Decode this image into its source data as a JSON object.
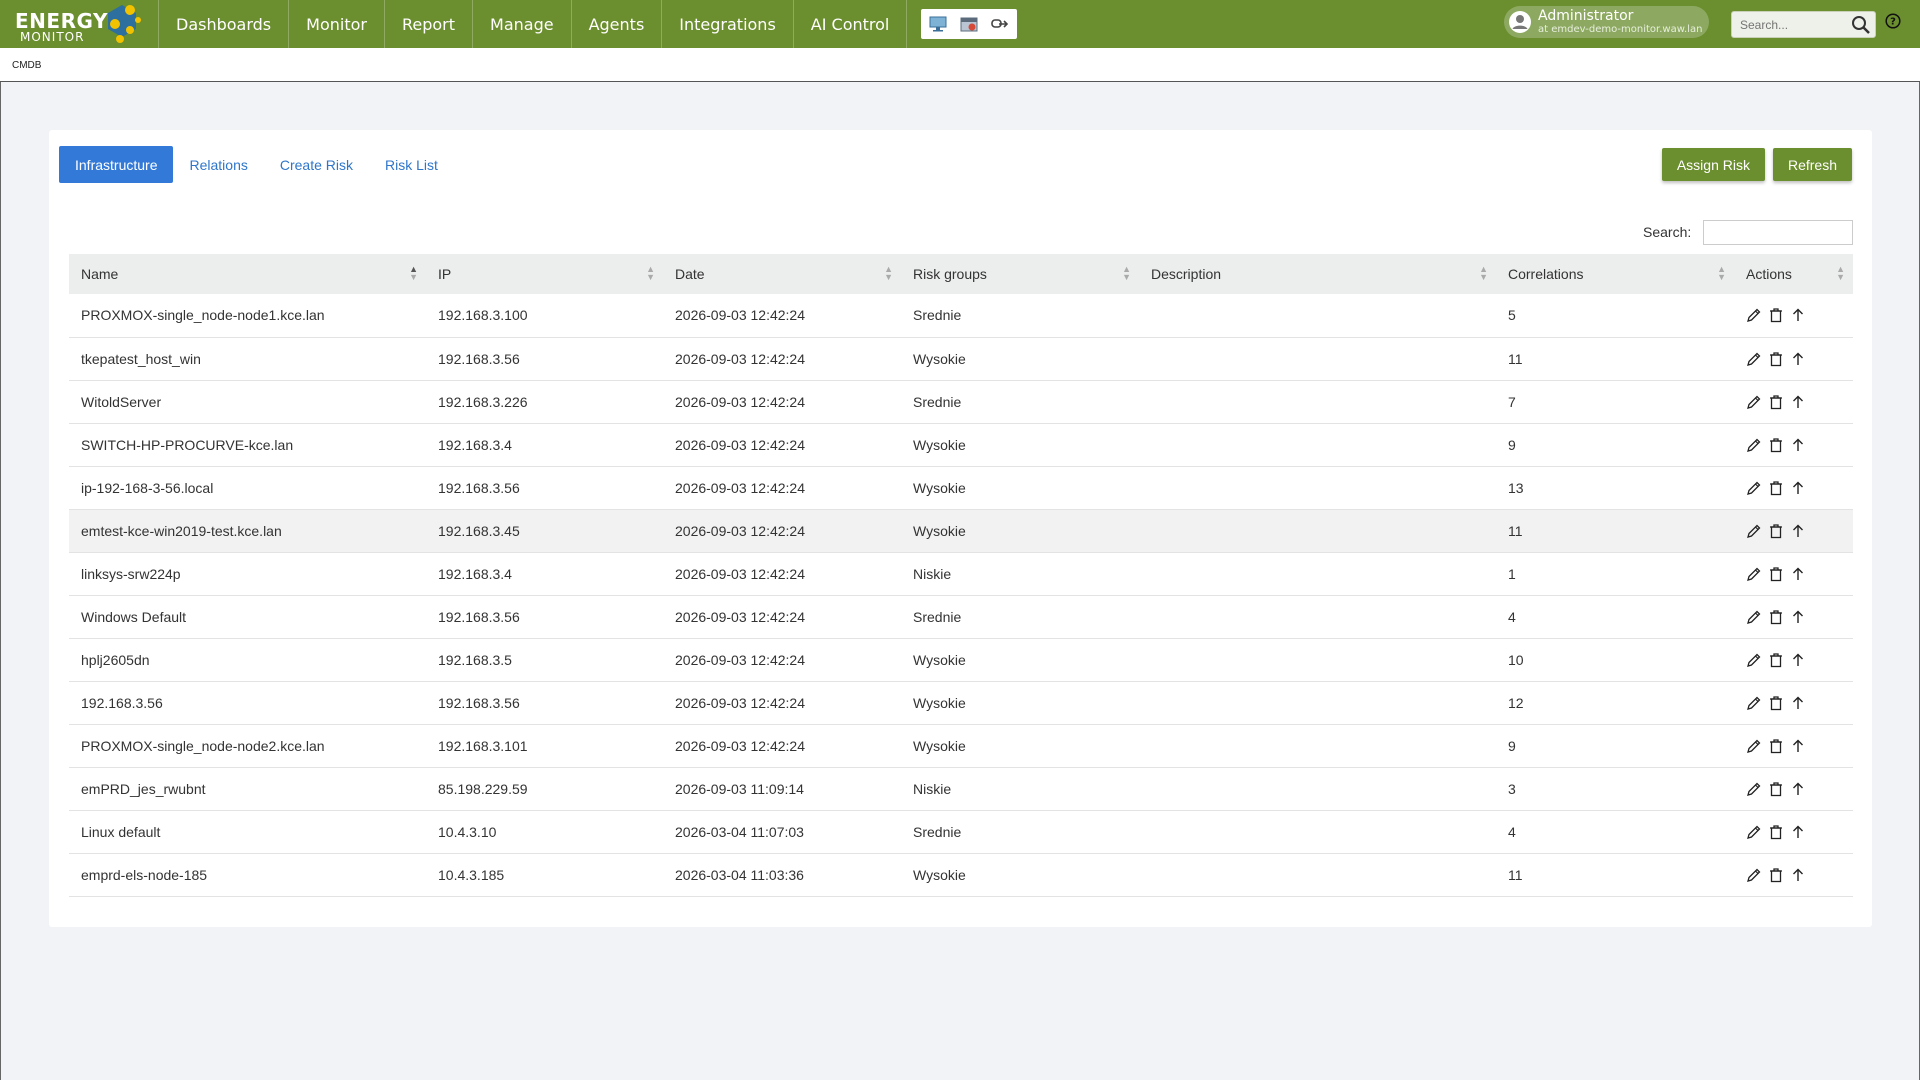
{
  "app": {
    "logo_line1": "ENERGY",
    "logo_line2": "MONITOR",
    "nav": [
      "Dashboards",
      "Monitor",
      "Report",
      "Manage",
      "Agents",
      "Integrations",
      "AI Control"
    ],
    "user_name": "Administrator",
    "user_host": "at emdev-demo-monitor.waw.lan",
    "search_placeholder": "Search..."
  },
  "breadcrumb": "CMDB",
  "tabs": [
    "Infrastructure",
    "Relations",
    "Create Risk",
    "Risk List"
  ],
  "active_tab": "Infrastructure",
  "buttons": {
    "assign": "Assign Risk",
    "refresh": "Refresh"
  },
  "table_search_label": "Search:",
  "columns": [
    "Name",
    "IP",
    "Date",
    "Risk groups",
    "Description",
    "Correlations",
    "Actions"
  ],
  "rows": [
    {
      "name": "PROXMOX-single_node-node1.kce.lan",
      "ip": "192.168.3.100",
      "date": "2026-09-03 12:42:24",
      "risk": "Srednie",
      "desc": "",
      "corr": "5"
    },
    {
      "name": "tkepatest_host_win",
      "ip": "192.168.3.56",
      "date": "2026-09-03 12:42:24",
      "risk": "Wysokie",
      "desc": "",
      "corr": "11"
    },
    {
      "name": "WitoldServer",
      "ip": "192.168.3.226",
      "date": "2026-09-03 12:42:24",
      "risk": "Srednie",
      "desc": "",
      "corr": "7"
    },
    {
      "name": "SWITCH-HP-PROCURVE-kce.lan",
      "ip": "192.168.3.4",
      "date": "2026-09-03 12:42:24",
      "risk": "Wysokie",
      "desc": "",
      "corr": "9"
    },
    {
      "name": "ip-192-168-3-56.local",
      "ip": "192.168.3.56",
      "date": "2026-09-03 12:42:24",
      "risk": "Wysokie",
      "desc": "",
      "corr": "13"
    },
    {
      "name": "emtest-kce-win2019-test.kce.lan",
      "ip": "192.168.3.45",
      "date": "2026-09-03 12:42:24",
      "risk": "Wysokie",
      "desc": "",
      "corr": "11"
    },
    {
      "name": "linksys-srw224p",
      "ip": "192.168.3.4",
      "date": "2026-09-03 12:42:24",
      "risk": "Niskie",
      "desc": "",
      "corr": "1"
    },
    {
      "name": "Windows Default",
      "ip": "192.168.3.56",
      "date": "2026-09-03 12:42:24",
      "risk": "Srednie",
      "desc": "",
      "corr": "4"
    },
    {
      "name": "hplj2605dn",
      "ip": "192.168.3.5",
      "date": "2026-09-03 12:42:24",
      "risk": "Wysokie",
      "desc": "",
      "corr": "10"
    },
    {
      "name": "192.168.3.56",
      "ip": "192.168.3.56",
      "date": "2026-09-03 12:42:24",
      "risk": "Wysokie",
      "desc": "",
      "corr": "12"
    },
    {
      "name": "PROXMOX-single_node-node2.kce.lan",
      "ip": "192.168.3.101",
      "date": "2026-09-03 12:42:24",
      "risk": "Wysokie",
      "desc": "",
      "corr": "9"
    },
    {
      "name": "emPRD_jes_rwubnt",
      "ip": "85.198.229.59",
      "date": "2026-09-03 11:09:14",
      "risk": "Niskie",
      "desc": "",
      "corr": "3"
    },
    {
      "name": "Linux default",
      "ip": "10.4.3.10",
      "date": "2026-03-04 11:07:03",
      "risk": "Srednie",
      "desc": "",
      "corr": "4"
    },
    {
      "name": "emprd-els-node-185",
      "ip": "10.4.3.185",
      "date": "2026-03-04 11:03:36",
      "risk": "Wysokie",
      "desc": "",
      "corr": "11"
    }
  ],
  "highlighted_row": 5,
  "row_action_icons": [
    "edit-icon",
    "delete-icon",
    "move-up-icon"
  ],
  "colors": {
    "brand_green": "#6b8e2e",
    "accent_blue": "#337ad8",
    "link_blue": "#2f76c9"
  }
}
